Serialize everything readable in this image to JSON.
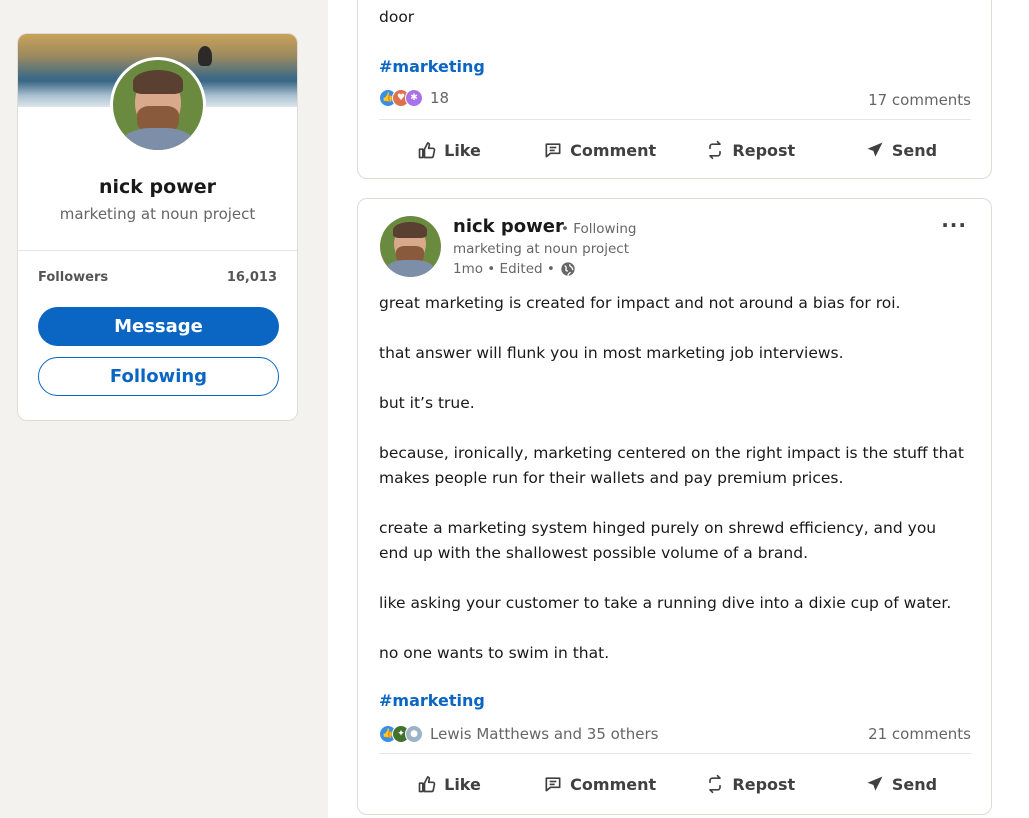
{
  "profile": {
    "name": "nick power",
    "title": "marketing at noun project",
    "followers_label": "Followers",
    "followers_count": "16,013",
    "message_label": "Message",
    "following_label": "Following"
  },
  "post_top": {
    "text_tail": "door",
    "hashtag": "#marketing",
    "reaction_count": "18",
    "comments": "17 comments"
  },
  "post_main": {
    "author": "nick power",
    "follow_status": "• Following",
    "author_title": "marketing at noun project",
    "meta": "1mo • Edited •",
    "lines": [
      "great marketing is created for impact and not around a bias for roi.",
      "that answer will flunk you in most marketing job interviews.",
      "but it’s true.",
      "because, ironically, marketing centered on the right impact is the stuff that",
      "makes people run for their wallets and pay premium prices.",
      "create a marketing system hinged purely on shrewd efficiency, and you",
      "end up with the shallowest possible volume of a brand.",
      "like asking your customer to take a running dive into a dixie cup of water.",
      "no one wants to swim in that."
    ],
    "hashtag": "#marketing",
    "reactions_text": "Lewis Matthews and 35 others",
    "comments": "21 comments",
    "more_label": "···"
  },
  "actions": {
    "like": "Like",
    "comment": "Comment",
    "repost": "Repost",
    "send": "Send"
  },
  "colors": {
    "brand_blue": "#0a66c2",
    "page_bg": "#f4f2ee"
  }
}
